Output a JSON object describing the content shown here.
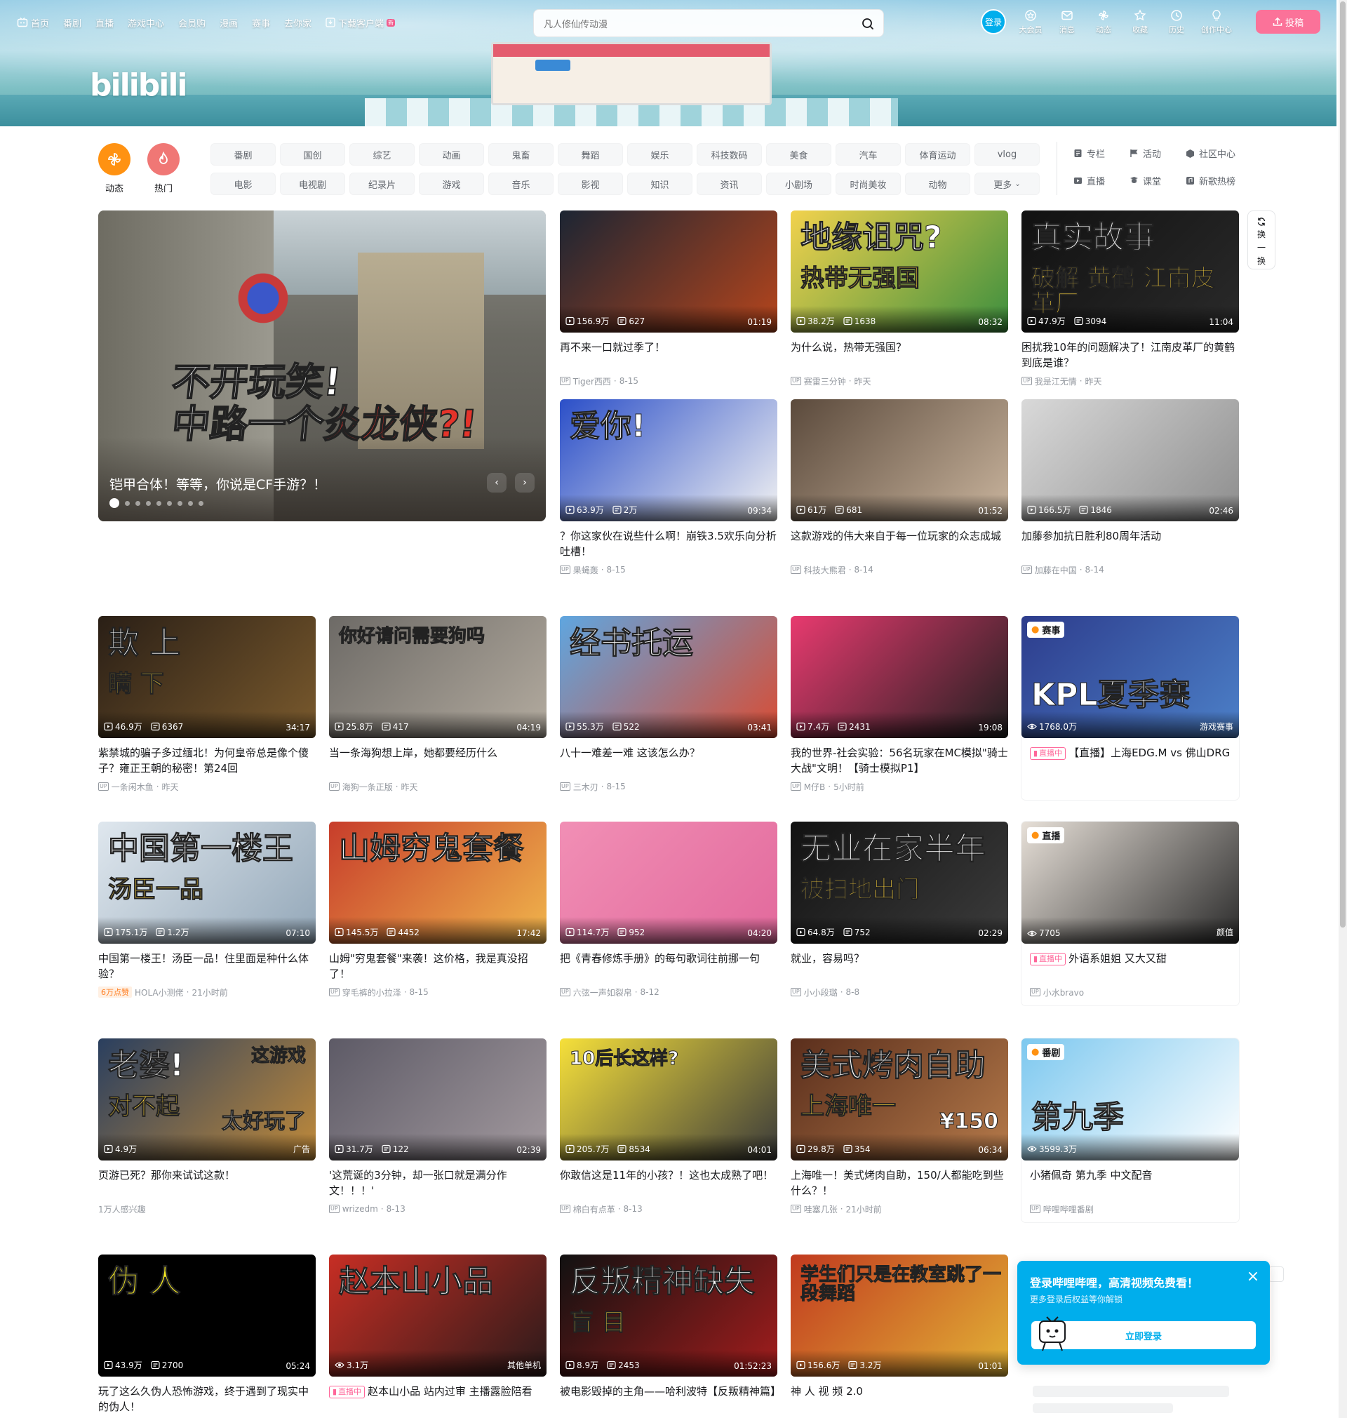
{
  "header": {
    "nav": [
      "首页",
      "番剧",
      "直播",
      "游戏中心",
      "会员购",
      "漫画",
      "赛事",
      "去你家",
      "下载客户端"
    ],
    "new_badge": "新",
    "search_placeholder": "凡人修仙传动漫",
    "login": "登录",
    "right_nav": [
      "大会员",
      "消息",
      "动态",
      "收藏",
      "历史",
      "创作中心"
    ],
    "upload": "投稿",
    "logo": "bilibili"
  },
  "channels": {
    "round": [
      "动态",
      "热门"
    ],
    "grid": [
      "番剧",
      "国创",
      "综艺",
      "动画",
      "鬼畜",
      "舞蹈",
      "娱乐",
      "科技数码",
      "美食",
      "汽车",
      "体育运动",
      "vlog",
      "电影",
      "电视剧",
      "纪录片",
      "游戏",
      "音乐",
      "影视",
      "知识",
      "资讯",
      "小剧场",
      "时尚美妆",
      "动物",
      "更多"
    ],
    "side": [
      "专栏",
      "活动",
      "社区中心",
      "直播",
      "课堂",
      "新歌热榜"
    ]
  },
  "carousel": {
    "title_line1": "不开玩笑!",
    "title_line2a": "中路一个",
    "title_line2b": "炎龙侠?!",
    "caption": "铠甲合体！等等，你说是CF手游？！",
    "dot_count": 9,
    "active_dot": 0
  },
  "refresh": {
    "label_a": "换",
    "label_b": "一",
    "label_c": "换"
  },
  "cards": [
    {
      "views": "156.9万",
      "danmaku": "627",
      "duration": "01:19",
      "title": "再不来一口就过季了！",
      "author": "Tiger西西",
      "date": "8-15",
      "thumb_text": "",
      "colors": [
        "#1c2533",
        "#b6451c"
      ]
    },
    {
      "views": "38.2万",
      "danmaku": "1638",
      "duration": "08:32",
      "title": "为什么说，热带无强国？",
      "author": "赛雷三分钟",
      "date": "昨天",
      "thumb_text": "地缘诅咒?",
      "thumb_text2": "热带无强国",
      "colors": [
        "#f2d24d",
        "#3b8e3e"
      ]
    },
    {
      "views": "47.9万",
      "danmaku": "3094",
      "duration": "11:04",
      "title": "困扰我10年的问题解决了！江南皮革厂的黄鹤到底是谁？",
      "author": "我是江无情",
      "date": "昨天",
      "thumb_text": "真实故事",
      "thumb_text2": "破解 黄鹤 江南皮革厂",
      "colors": [
        "#111",
        "#2a2a2a"
      ]
    },
    {
      "views": "63.9万",
      "danmaku": "2万",
      "duration": "09:34",
      "title": "？你这家伙在说些什么啊！崩铁3.5欢乐向分析吐槽！",
      "author": "果蝇轰",
      "date": "8-15",
      "thumb_text": "爱你!",
      "colors": [
        "#2b4fc8",
        "#f2f2f2"
      ]
    },
    {
      "views": "61万",
      "danmaku": "681",
      "duration": "01:52",
      "title": "这款游戏的伟大来自于每一位玩家的众志成城",
      "author": "科技大熊君",
      "date": "8-14",
      "thumb_text": "",
      "colors": [
        "#5b4a3c",
        "#c9b49d"
      ]
    },
    {
      "views": "166.5万",
      "danmaku": "1846",
      "duration": "02:46",
      "title": "加藤参加抗日胜利80周年活动",
      "author": "加藤在中国",
      "date": "8-14",
      "thumb_text": "",
      "colors": [
        "#d9d9d9",
        "#8d8d8d"
      ]
    },
    {
      "views": "46.9万",
      "danmaku": "6367",
      "duration": "34:17",
      "title": "紫禁城的骗子多过缅北！为何皇帝总是像个傻子？雍正王朝的秘密！第24回",
      "author": "一条闲木鱼",
      "date": "昨天",
      "thumb_text": "欺 上",
      "thumb_text2": "瞒 下",
      "colors": [
        "#2a1f16",
        "#7a5a2d"
      ]
    },
    {
      "views": "25.8万",
      "danmaku": "417",
      "duration": "04:19",
      "title": "当一条海狗想上岸，她都要经历什么",
      "author": "海狗一条正版",
      "date": "昨天",
      "thumb_text": "你好请问需要狗吗",
      "colors": [
        "#6d6a66",
        "#b3ab9f"
      ]
    },
    {
      "views": "55.3万",
      "danmaku": "522",
      "duration": "03:41",
      "title": "八十一难差一难 这该怎么办？",
      "author": "三木刃",
      "date": "8-15",
      "thumb_text": "经书托运",
      "colors": [
        "#5fa6e0",
        "#d94c33"
      ]
    },
    {
      "views": "7.4万",
      "danmaku": "2431",
      "duration": "19:08",
      "title": "我的世界-社会实验：56名玩家在MC模拟\"骑士大战\"文明！【骑士模拟P1】",
      "author": "M仔B",
      "date": "5小时前",
      "thumb_text": "",
      "colors": [
        "#e83a6f",
        "#1f1f1f"
      ]
    },
    {
      "views": "1768.0万",
      "danmaku": "",
      "duration": "",
      "title": "【直播】上海EDG.M vs 佛山DRG",
      "author": "",
      "date": "",
      "badge": "赛事",
      "tag": "直播中",
      "right_label": "游戏赛事",
      "thumb_text": "KPL夏季赛",
      "colors": [
        "#2d3c8c",
        "#4c80c8"
      ]
    },
    {
      "views": "175.1万",
      "danmaku": "1.2万",
      "duration": "07:10",
      "title": "中国第一楼王！汤臣一品！住里面是种什么体验？",
      "author": "HOLA小测佬",
      "date": "21小时前",
      "hot": "6万点赞",
      "thumb_text": "中国第一楼王",
      "thumb_text2": "汤臣一品",
      "colors": [
        "#dfe7ee",
        "#93a7b8"
      ]
    },
    {
      "views": "145.5万",
      "danmaku": "4452",
      "duration": "17:42",
      "title": "山姆\"穷鬼套餐\"来袭！这价格，我是真没招了！",
      "author": "穿毛裤的小拉泽",
      "date": "8-15",
      "thumb_text": "山姆穷鬼套餐",
      "colors": [
        "#c73d2b",
        "#f0b54c"
      ]
    },
    {
      "views": "114.7万",
      "danmaku": "952",
      "duration": "04:20",
      "title": "把《青春修炼手册》的每句歌词往前挪一句",
      "author": "六弦一声如裂帛",
      "date": "8-12",
      "thumb_text": "",
      "colors": [
        "#f18fb5",
        "#e2699c"
      ]
    },
    {
      "views": "64.8万",
      "danmaku": "752",
      "duration": "02:29",
      "title": "就业，容易吗？",
      "author": "小小段璐",
      "date": "8-8",
      "thumb_text": "无业在家半年",
      "thumb_text2": "被扫地出门",
      "colors": [
        "#121212",
        "#3c3c3c"
      ]
    },
    {
      "views": "7705",
      "danmaku": "",
      "duration": "",
      "title": "外语系姐姐 又大又甜",
      "author": "小水bravo",
      "date": "",
      "badge": "直播",
      "tag": "直播中",
      "right_label": "颜值",
      "thumb_text": "",
      "colors": [
        "#e7e0d8",
        "#2a2a2a"
      ]
    },
    {
      "views": "4.9万",
      "danmaku": "",
      "duration": "",
      "title": "页游已死？那你来试试这款！",
      "author": "1万人感兴趣",
      "date": "",
      "ad": "广告",
      "thumb_text": "老婆!",
      "thumb_text2": "对不起",
      "thumb_text3": "太好玩了",
      "corner_text": "这游戏",
      "colors": [
        "#2a3f5f",
        "#c08a3a"
      ]
    },
    {
      "views": "31.7万",
      "danmaku": "122",
      "duration": "02:39",
      "title": "'这荒诞的3分钟，却一张口就是满分作文！！！'",
      "author": "wrizedm",
      "date": "8-13",
      "thumb_text": "",
      "colors": [
        "#5d5a66",
        "#a39a9f"
      ]
    },
    {
      "views": "205.7万",
      "danmaku": "8534",
      "duration": "04:01",
      "title": "你敢信这是11年的小孩？！这也太成熟了吧！",
      "author": "棉白有点革",
      "date": "8-13",
      "thumb_text": "10后长这样?",
      "colors": [
        "#f6e03a",
        "#3a3a3a"
      ]
    },
    {
      "views": "29.8万",
      "danmaku": "354",
      "duration": "06:34",
      "title": "上海唯一！美式烤肉自助，150/人都能吃到些什么？！",
      "author": "哇塞几张",
      "date": "21小时前",
      "thumb_text": "美式烤肉自助",
      "thumb_text2": "上海唯一",
      "thumb_text3": "¥150",
      "colors": [
        "#5a2e1c",
        "#b57a4a"
      ]
    },
    {
      "views": "3599.3万",
      "danmaku": "",
      "duration": "",
      "title": "小猪佩奇 第九季 中文配音",
      "author": "哔哩哔哩番剧",
      "date": "",
      "badge": "番剧",
      "thumb_text": "第九季",
      "colors": [
        "#7dc8ef",
        "#ffffff"
      ]
    },
    {
      "views": "43.9万",
      "danmaku": "2700",
      "duration": "05:24",
      "title": "玩了这么久伪人恐怖游戏，终于遇到了现实中的伪人！",
      "author": "",
      "date": "",
      "thumb_text": "伪 人",
      "colors": [
        "#000000",
        "#000000"
      ]
    },
    {
      "views": "3.1万",
      "danmaku": "",
      "duration": "",
      "title": "赵本山小品 站内过审 主播露脸陪看",
      "author": "",
      "date": "",
      "tag": "直播中",
      "right_label": "其他单机",
      "thumb_text": "赵本山小品",
      "colors": [
        "#c72e24",
        "#2a1a1a"
      ]
    },
    {
      "views": "8.9万",
      "danmaku": "2453",
      "duration": "01:52:23",
      "title": "被电影毁掉的主角——哈利波特【反叛精神篇】",
      "author": "",
      "date": "",
      "thumb_text": "反叛精神缺失",
      "thumb_text2": "盲 目",
      "colors": [
        "#111111",
        "#a31d1d"
      ]
    },
    {
      "views": "156.6万",
      "danmaku": "3.2万",
      "duration": "01:01",
      "title": "神 人 视 频 2.0",
      "author": "",
      "date": "",
      "thumb_text": "学生们只是在教室跳了一段舞蹈",
      "colors": [
        "#c13a1f",
        "#e2b236"
      ]
    }
  ],
  "popup": {
    "title": "登录哔哩哔哩，高清视频免费看！",
    "subtitle": "更多登录后权益等你解锁",
    "button": "立即登录"
  }
}
